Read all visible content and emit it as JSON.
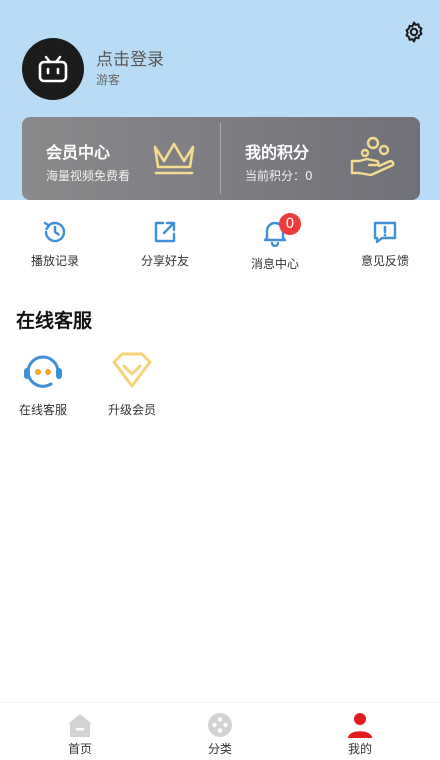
{
  "header": {
    "login_text": "点击登录",
    "user_role": "游客",
    "settings_icon": "gear-icon",
    "avatar_icon": "bilibili-tv-icon",
    "bg_color": "#b9dcf6"
  },
  "vip": {
    "member": {
      "title": "会员中心",
      "subtitle": "海量视频免费看",
      "icon": "crown-icon"
    },
    "points": {
      "title": "我的积分",
      "subtitle": "当前积分：0",
      "icon": "hand-coins-icon"
    }
  },
  "quick_actions": [
    {
      "label": "播放记录",
      "icon": "history-icon"
    },
    {
      "label": "分享好友",
      "icon": "share-icon"
    },
    {
      "label": "消息中心",
      "icon": "bell-icon",
      "badge": "0"
    },
    {
      "label": "意见反馈",
      "icon": "feedback-icon"
    }
  ],
  "section": {
    "title": "在线客服"
  },
  "services": [
    {
      "label": "在线客服",
      "icon": "customer-service-icon"
    },
    {
      "label": "升级会员",
      "icon": "diamond-icon"
    }
  ],
  "tabbar": [
    {
      "label": "首页",
      "icon": "home-icon",
      "active": false
    },
    {
      "label": "分类",
      "icon": "category-icon",
      "active": false
    },
    {
      "label": "我的",
      "icon": "user-icon",
      "active": true
    }
  ],
  "colors": {
    "accent": "#3f8fd9",
    "badge": "#ef3b3b",
    "active_tab": "#e11d1d",
    "gold": "#f3dc8e"
  }
}
